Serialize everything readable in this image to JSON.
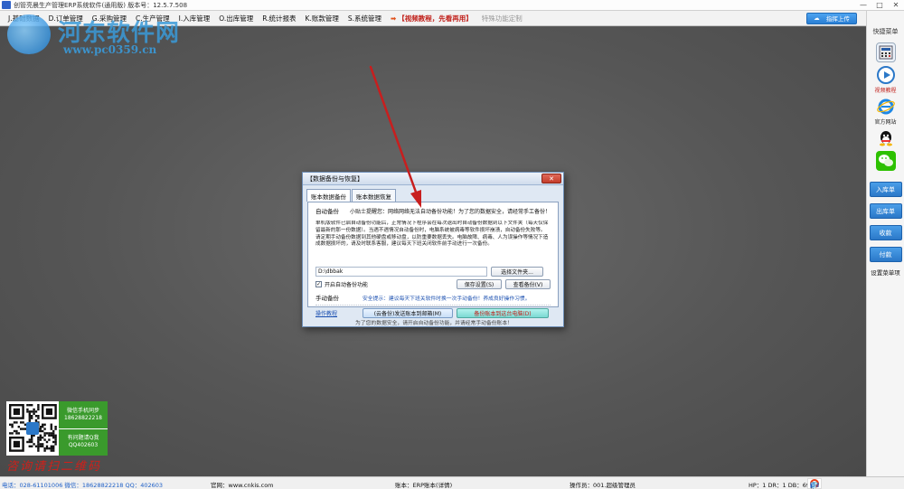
{
  "window": {
    "title": "创管亮晨生产管理ERP系统软件(通用版) 版本号：12.5.7.508",
    "minimize_glyph": "—",
    "maximize_glyph": "□",
    "close_glyph": "✕"
  },
  "menubar": {
    "items": [
      "J.基础数据",
      "D.订单管理",
      "G.采购管理",
      "C.生产管理",
      "I.入库管理",
      "O.出库管理",
      "R.统计报表",
      "K.账款管理",
      "S.系统管理"
    ],
    "tutorial_link": "【视频教程，先看再用】",
    "extra_item": "特殊功能定制",
    "pin_button": "指挥上传"
  },
  "watermark": {
    "title": "河东软件网",
    "url": "www.pc0359.cn"
  },
  "sidepanel": {
    "title": "快捷菜单",
    "shortcuts": [
      {
        "label": "",
        "icon": "calculator-icon"
      },
      {
        "label": "视频教程",
        "icon": "play-icon",
        "red": true
      },
      {
        "label": "官方网站",
        "icon": "ie-icon"
      },
      {
        "label": "",
        "icon": "qq-icon"
      },
      {
        "label": "",
        "icon": "wechat-icon"
      }
    ],
    "buttons": [
      "入库单",
      "出库单",
      "收款",
      "付款"
    ],
    "settings_link": "设置菜单项"
  },
  "qr": {
    "cell1": "微信手机同步 18628822218",
    "cell2": "有问题请Q我 QQ402603",
    "banner": "咨询请扫二维码"
  },
  "dialog": {
    "title": "【数据备份与恢复】",
    "close_glyph": "✕",
    "tabs": [
      "账本数据备份",
      "账本数据恢复"
    ],
    "auto_label": "自动备份",
    "tip": "小贴士提醒您：网络网络无法自动备份功能！为了您的数据安全，请经常手工备份！",
    "paragraph": "单机版软件已启自动备份功能后，正常情况下程序会在每次退出时自动备份数据到以下文件夹（每天仅保留最新的那一份数据）。当遇不遇情况自动备份时，电脑系统被病毒等软件损坏崩溃，自动备份失败等。请定期手动备份数据到其他硬盘或移动盘，以防重要数据丢失。电脑故障、病毒、人为误操作等情况下造成数据损坏的，请及时联系客服，建议每天下班关闭软件前手动进行一次备份。",
    "path_value": "D:\\dbbak",
    "choose_folder": "选择文件夹...",
    "enable_auto": "开启自动备份功能",
    "save_settings": "保存设置(S)",
    "view_backup": "查看备份(V)",
    "manual_label": "手动备份",
    "safety_tip": "安全提示：建议每天下班关软件时换一次手动备份！养成良好操作习惯。",
    "help_link": "操作教程",
    "cloud_backup": "(云备份)发送账本到邮箱(M)",
    "local_backup": "备份账本到这台电脑(D)",
    "footer": "为了您的数据安全，请开启自动备份功能，并请经常手动备份账本！"
  },
  "statusbar": {
    "phone": "电话：028-61101006 微信：18628822218 QQ：402603",
    "website": "官网：www.cnkis.com",
    "account": "账本：ERP账本(详情)",
    "operator": "操作员：001.超级管理员",
    "hp": "HP：1 DR：1 DB：69",
    "ime_items": [
      "中",
      "°",
      "♪",
      "⌨",
      "🎤",
      "▦",
      "👕",
      "⚙"
    ]
  },
  "colors": {
    "accent": "#2a7fd4",
    "tutorial": "#c0201a",
    "qr_green": "#3a9a2c",
    "arrow": "#c81e1e"
  }
}
